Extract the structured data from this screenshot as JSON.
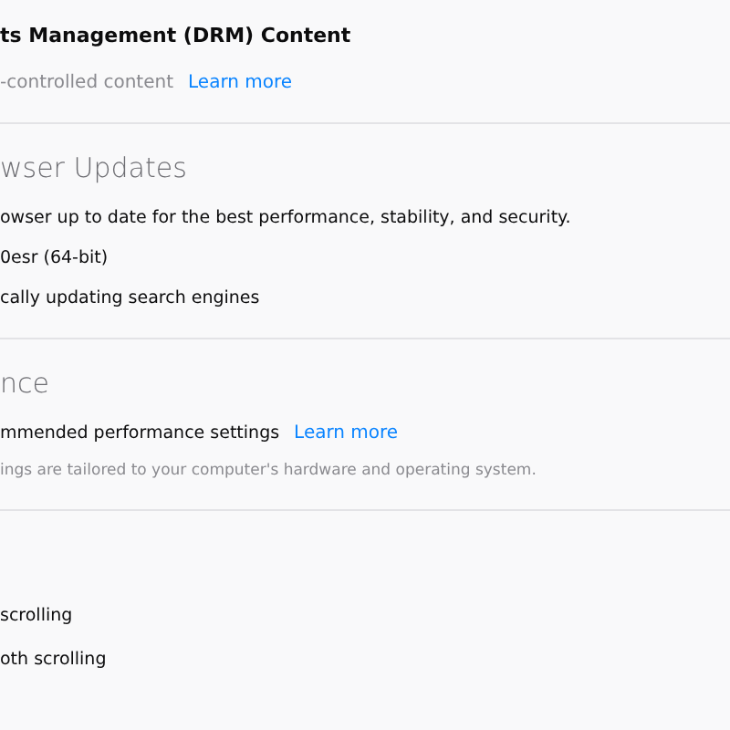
{
  "sections": [
    {
      "kind": "drm",
      "title": "ts Management (DRM) Content",
      "description": "-controlled content",
      "link": "Learn more"
    },
    {
      "kind": "updates",
      "heading": "wser Updates",
      "lines": [
        "owser up to date for the best performance, stability, and security.",
        "0esr (64-bit)",
        "cally updating search engines"
      ]
    },
    {
      "kind": "performance",
      "heading": "nce",
      "option": "mmended performance settings",
      "link": "Learn more",
      "note": "ings are tailored to your computer's hardware and operating system."
    },
    {
      "kind": "browsing",
      "lines": [
        "scrolling",
        "oth scrolling"
      ]
    }
  ]
}
